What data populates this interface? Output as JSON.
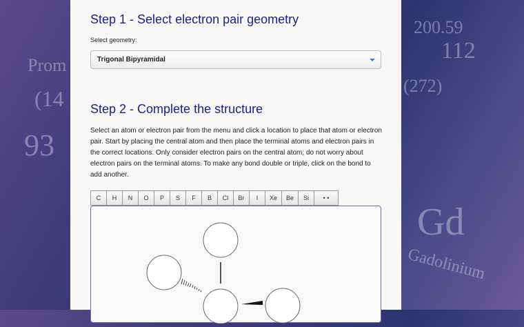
{
  "step1": {
    "title": "Step 1 - Select electron pair geometry",
    "select_label": "Select geometry:",
    "selected": "Trigonal Bipyramidal"
  },
  "step2": {
    "title": "Step 2 - Complete the structure",
    "description": "Select an atom or electron pair from the menu and click a location to place that atom or electron pair. Start by placing the central atom and then place the terminal atoms and electron pairs in the correct locations. Only consider electron pairs on the central atom; do not worry about electron pairs on the terminal atoms. To make any bond double or triple, click on the bond to add another.",
    "toolbar": [
      "C",
      "H",
      "N",
      "O",
      "P",
      "S",
      "F",
      "B",
      "Cl",
      "Br",
      "I",
      "Xe",
      "Be",
      "Si",
      "• •"
    ]
  },
  "colors": {
    "heading": "#1a1f8a",
    "panel": "#f9f8f7"
  }
}
